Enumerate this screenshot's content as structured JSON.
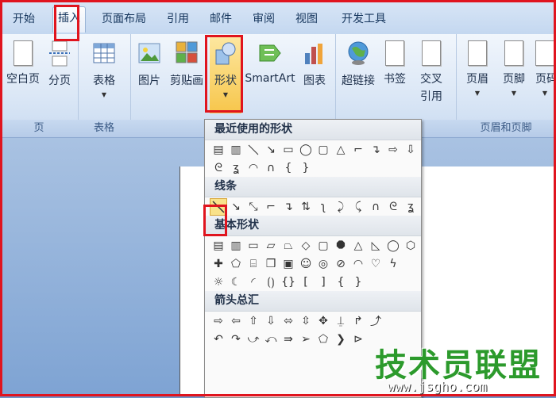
{
  "tabs": [
    "开始",
    "插入",
    "页面布局",
    "引用",
    "邮件",
    "审阅",
    "视图",
    "开发工具"
  ],
  "active_tab": "插入",
  "ribbon": {
    "groups": [
      {
        "label": "页",
        "buttons": [
          "空白页",
          "分页"
        ]
      },
      {
        "label": "表格",
        "buttons": [
          "表格"
        ]
      },
      {
        "label": "",
        "buttons": [
          "图片",
          "剪贴画",
          "形状",
          "SmartArt",
          "图表"
        ]
      },
      {
        "label": "",
        "buttons": [
          "超链接",
          "书签",
          "交叉",
          "引用"
        ]
      },
      {
        "label": "页眉和页脚",
        "buttons": [
          "页眉",
          "页脚",
          "页码"
        ]
      }
    ]
  },
  "shapes_menu": {
    "sections": [
      "最近使用的形状",
      "线条",
      "基本形状",
      "箭头总汇"
    ]
  },
  "watermark": {
    "text": "技术员联盟",
    "url": "www.jsgho.com"
  },
  "colors": {
    "highlight": "#e0141e",
    "selected": "#f9e28a"
  }
}
